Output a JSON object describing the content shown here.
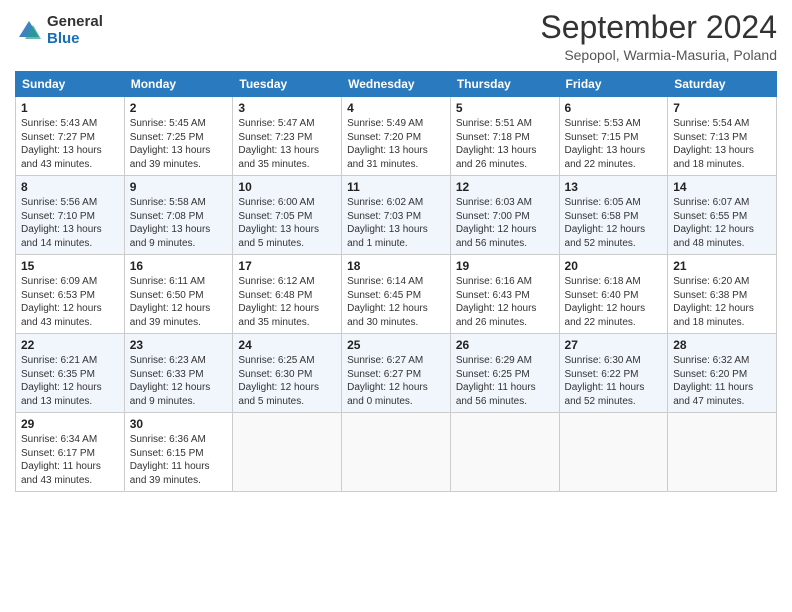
{
  "header": {
    "logo_general": "General",
    "logo_blue": "Blue",
    "month_title": "September 2024",
    "location": "Sepopol, Warmia-Masuria, Poland"
  },
  "weekdays": [
    "Sunday",
    "Monday",
    "Tuesday",
    "Wednesday",
    "Thursday",
    "Friday",
    "Saturday"
  ],
  "weeks": [
    [
      {
        "day": "1",
        "info": "Sunrise: 5:43 AM\nSunset: 7:27 PM\nDaylight: 13 hours\nand 43 minutes."
      },
      {
        "day": "2",
        "info": "Sunrise: 5:45 AM\nSunset: 7:25 PM\nDaylight: 13 hours\nand 39 minutes."
      },
      {
        "day": "3",
        "info": "Sunrise: 5:47 AM\nSunset: 7:23 PM\nDaylight: 13 hours\nand 35 minutes."
      },
      {
        "day": "4",
        "info": "Sunrise: 5:49 AM\nSunset: 7:20 PM\nDaylight: 13 hours\nand 31 minutes."
      },
      {
        "day": "5",
        "info": "Sunrise: 5:51 AM\nSunset: 7:18 PM\nDaylight: 13 hours\nand 26 minutes."
      },
      {
        "day": "6",
        "info": "Sunrise: 5:53 AM\nSunset: 7:15 PM\nDaylight: 13 hours\nand 22 minutes."
      },
      {
        "day": "7",
        "info": "Sunrise: 5:54 AM\nSunset: 7:13 PM\nDaylight: 13 hours\nand 18 minutes."
      }
    ],
    [
      {
        "day": "8",
        "info": "Sunrise: 5:56 AM\nSunset: 7:10 PM\nDaylight: 13 hours\nand 14 minutes."
      },
      {
        "day": "9",
        "info": "Sunrise: 5:58 AM\nSunset: 7:08 PM\nDaylight: 13 hours\nand 9 minutes."
      },
      {
        "day": "10",
        "info": "Sunrise: 6:00 AM\nSunset: 7:05 PM\nDaylight: 13 hours\nand 5 minutes."
      },
      {
        "day": "11",
        "info": "Sunrise: 6:02 AM\nSunset: 7:03 PM\nDaylight: 13 hours\nand 1 minute."
      },
      {
        "day": "12",
        "info": "Sunrise: 6:03 AM\nSunset: 7:00 PM\nDaylight: 12 hours\nand 56 minutes."
      },
      {
        "day": "13",
        "info": "Sunrise: 6:05 AM\nSunset: 6:58 PM\nDaylight: 12 hours\nand 52 minutes."
      },
      {
        "day": "14",
        "info": "Sunrise: 6:07 AM\nSunset: 6:55 PM\nDaylight: 12 hours\nand 48 minutes."
      }
    ],
    [
      {
        "day": "15",
        "info": "Sunrise: 6:09 AM\nSunset: 6:53 PM\nDaylight: 12 hours\nand 43 minutes."
      },
      {
        "day": "16",
        "info": "Sunrise: 6:11 AM\nSunset: 6:50 PM\nDaylight: 12 hours\nand 39 minutes."
      },
      {
        "day": "17",
        "info": "Sunrise: 6:12 AM\nSunset: 6:48 PM\nDaylight: 12 hours\nand 35 minutes."
      },
      {
        "day": "18",
        "info": "Sunrise: 6:14 AM\nSunset: 6:45 PM\nDaylight: 12 hours\nand 30 minutes."
      },
      {
        "day": "19",
        "info": "Sunrise: 6:16 AM\nSunset: 6:43 PM\nDaylight: 12 hours\nand 26 minutes."
      },
      {
        "day": "20",
        "info": "Sunrise: 6:18 AM\nSunset: 6:40 PM\nDaylight: 12 hours\nand 22 minutes."
      },
      {
        "day": "21",
        "info": "Sunrise: 6:20 AM\nSunset: 6:38 PM\nDaylight: 12 hours\nand 18 minutes."
      }
    ],
    [
      {
        "day": "22",
        "info": "Sunrise: 6:21 AM\nSunset: 6:35 PM\nDaylight: 12 hours\nand 13 minutes."
      },
      {
        "day": "23",
        "info": "Sunrise: 6:23 AM\nSunset: 6:33 PM\nDaylight: 12 hours\nand 9 minutes."
      },
      {
        "day": "24",
        "info": "Sunrise: 6:25 AM\nSunset: 6:30 PM\nDaylight: 12 hours\nand 5 minutes."
      },
      {
        "day": "25",
        "info": "Sunrise: 6:27 AM\nSunset: 6:27 PM\nDaylight: 12 hours\nand 0 minutes."
      },
      {
        "day": "26",
        "info": "Sunrise: 6:29 AM\nSunset: 6:25 PM\nDaylight: 11 hours\nand 56 minutes."
      },
      {
        "day": "27",
        "info": "Sunrise: 6:30 AM\nSunset: 6:22 PM\nDaylight: 11 hours\nand 52 minutes."
      },
      {
        "day": "28",
        "info": "Sunrise: 6:32 AM\nSunset: 6:20 PM\nDaylight: 11 hours\nand 47 minutes."
      }
    ],
    [
      {
        "day": "29",
        "info": "Sunrise: 6:34 AM\nSunset: 6:17 PM\nDaylight: 11 hours\nand 43 minutes."
      },
      {
        "day": "30",
        "info": "Sunrise: 6:36 AM\nSunset: 6:15 PM\nDaylight: 11 hours\nand 39 minutes."
      },
      {
        "day": "",
        "info": ""
      },
      {
        "day": "",
        "info": ""
      },
      {
        "day": "",
        "info": ""
      },
      {
        "day": "",
        "info": ""
      },
      {
        "day": "",
        "info": ""
      }
    ]
  ]
}
